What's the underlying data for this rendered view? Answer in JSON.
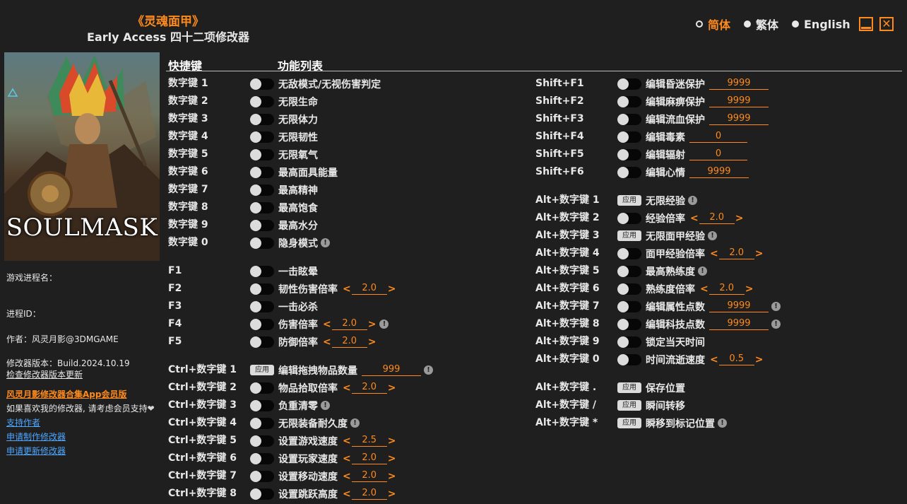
{
  "header": {
    "title": "《灵魂面甲》",
    "subtitle": "Early Access 四十二项修改器"
  },
  "languages": [
    {
      "label": "简体",
      "active": true
    },
    {
      "label": "繁体",
      "active": false
    },
    {
      "label": "English",
      "active": false
    }
  ],
  "window": {
    "minimize_icon": "minimize-icon",
    "close_icon": "close-icon",
    "close_glyph": "✕"
  },
  "cover": {
    "logo_text": "SOULMASK"
  },
  "sidebar": {
    "process_name": "游戏进程名：",
    "process_id": "进程ID：",
    "author": "作者：风灵月影@3DMGAME",
    "version": "修改器版本：Build.2024.10.19",
    "check_update": "检查修改器版本更新",
    "vip_link": "风灵月影修改器合集App会员版",
    "support_text": "如果喜欢我的修改器, 请考虑会员支持",
    "heart_icon": "heart-icon",
    "heart_glyph": "❤",
    "links": [
      "支持作者",
      "申请制作修改器",
      "申请更新修改器"
    ]
  },
  "columns": {
    "hotkey": "快捷键",
    "function_list": "功能列表"
  },
  "colors": {
    "accent": "#ff8a1c",
    "background": "#1f1f1f",
    "link": "#4ea6ff"
  },
  "apply_label": "应用",
  "info_glyph": "!",
  "arrow_left": "<",
  "arrow_right": ">",
  "left_rows": [
    {
      "key": "数字键 1",
      "control": "toggle",
      "label": "无敌模式/无视伤害判定"
    },
    {
      "key": "数字键 2",
      "control": "toggle",
      "label": "无限生命"
    },
    {
      "key": "数字键 3",
      "control": "toggle",
      "label": "无限体力"
    },
    {
      "key": "数字键 4",
      "control": "toggle",
      "label": "无限韧性"
    },
    {
      "key": "数字键 5",
      "control": "toggle",
      "label": "无限氧气"
    },
    {
      "key": "数字键 6",
      "control": "toggle",
      "label": "最高面具能量"
    },
    {
      "key": "数字键 7",
      "control": "toggle",
      "label": "最高精神"
    },
    {
      "key": "数字键 8",
      "control": "toggle",
      "label": "最高饱食"
    },
    {
      "key": "数字键 9",
      "control": "toggle",
      "label": "最高水分"
    },
    {
      "key": "数字键 0",
      "control": "toggle",
      "label": "隐身模式",
      "info": true
    },
    {
      "key": "F1",
      "control": "toggle",
      "label": "一击眩晕",
      "gap": true
    },
    {
      "key": "F2",
      "control": "toggle",
      "label": "韧性伤害倍率",
      "stepper": "2.0"
    },
    {
      "key": "F3",
      "control": "toggle",
      "label": "一击必杀"
    },
    {
      "key": "F4",
      "control": "toggle",
      "label": "伤害倍率",
      "stepper": "2.0",
      "info": true
    },
    {
      "key": "F5",
      "control": "toggle",
      "label": "防御倍率",
      "stepper": "2.0"
    },
    {
      "key": "Ctrl+数字键 1",
      "control": "apply",
      "label": "编辑拖拽物品数量",
      "input": "999",
      "info": true,
      "gap": true
    },
    {
      "key": "Ctrl+数字键 2",
      "control": "toggle",
      "label": "物品拾取倍率",
      "stepper": "2.0"
    },
    {
      "key": "Ctrl+数字键 3",
      "control": "toggle",
      "label": "负重清零",
      "info": true
    },
    {
      "key": "Ctrl+数字键 4",
      "control": "toggle",
      "label": "无限装备耐久度",
      "info": true
    },
    {
      "key": "Ctrl+数字键 5",
      "control": "toggle",
      "label": "设置游戏速度",
      "stepper": "2.5"
    },
    {
      "key": "Ctrl+数字键 6",
      "control": "toggle",
      "label": "设置玩家速度",
      "stepper": "2.0"
    },
    {
      "key": "Ctrl+数字键 7",
      "control": "toggle",
      "label": "设置移动速度",
      "stepper": "2.0"
    },
    {
      "key": "Ctrl+数字键 8",
      "control": "toggle",
      "label": "设置跳跃高度",
      "stepper": "2.0"
    }
  ],
  "right_rows": [
    {
      "key": "Shift+F1",
      "control": "toggle",
      "label": "编辑昏迷保护",
      "input": "9999"
    },
    {
      "key": "Shift+F2",
      "control": "toggle",
      "label": "编辑麻痹保护",
      "input": "9999"
    },
    {
      "key": "Shift+F3",
      "control": "toggle",
      "label": "编辑流血保护",
      "input": "9999"
    },
    {
      "key": "Shift+F4",
      "control": "toggle",
      "label": "编辑毒素",
      "input": "0"
    },
    {
      "key": "Shift+F5",
      "control": "toggle",
      "label": "编辑辐射",
      "input": "0"
    },
    {
      "key": "Shift+F6",
      "control": "toggle",
      "label": "编辑心情",
      "input": "9999"
    },
    {
      "key": "Alt+数字键 1",
      "control": "apply",
      "label": "无限经验",
      "info": true,
      "gap": true
    },
    {
      "key": "Alt+数字键 2",
      "control": "toggle",
      "label": "经验倍率",
      "stepper": "2.0"
    },
    {
      "key": "Alt+数字键 3",
      "control": "apply",
      "label": "无限面甲经验",
      "info": true
    },
    {
      "key": "Alt+数字键 4",
      "control": "toggle",
      "label": "面甲经验倍率",
      "stepper": "2.0"
    },
    {
      "key": "Alt+数字键 5",
      "control": "toggle",
      "label": "最高熟练度",
      "info": true
    },
    {
      "key": "Alt+数字键 6",
      "control": "toggle",
      "label": "熟练度倍率",
      "stepper": "2.0"
    },
    {
      "key": "Alt+数字键 7",
      "control": "toggle",
      "label": "编辑属性点数",
      "input": "9999",
      "info": true
    },
    {
      "key": "Alt+数字键 8",
      "control": "toggle",
      "label": "编辑科技点数",
      "input": "9999",
      "info": true
    },
    {
      "key": "Alt+数字键 9",
      "control": "toggle",
      "label": "锁定当天时间"
    },
    {
      "key": "Alt+数字键 0",
      "control": "toggle",
      "label": "时间流逝速度",
      "stepper": "0.5"
    },
    {
      "key": "Alt+数字键 .",
      "control": "apply",
      "label": "保存位置",
      "gap": true
    },
    {
      "key": "Alt+数字键 /",
      "control": "apply",
      "label": "瞬间转移"
    },
    {
      "key": "Alt+数字键 *",
      "control": "apply",
      "label": "瞬移到标记位置",
      "info": true
    }
  ]
}
